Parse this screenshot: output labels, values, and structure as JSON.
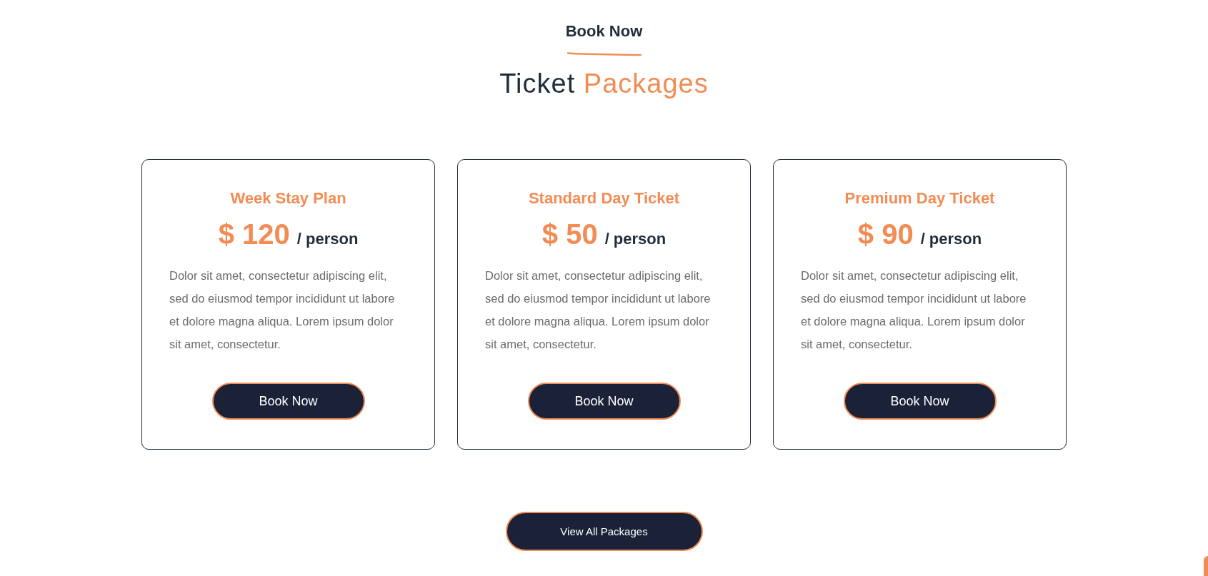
{
  "header": {
    "eyebrow": "Book Now",
    "title": {
      "lead": "Ticket",
      "accent": "Packages"
    }
  },
  "packages": [
    {
      "name": "Week Stay Plan",
      "price": "$ 120",
      "unit": "/ person",
      "description": "Dolor sit amet, consectetur adipiscing elit, sed do eiusmod tempor incididunt ut labore et dolore magna aliqua. Lorem ipsum dolor sit amet, consectetur.",
      "button": "Book Now"
    },
    {
      "name": "Standard Day Ticket",
      "price": "$ 50",
      "unit": "/ person",
      "description": "Dolor sit amet, consectetur adipiscing elit, sed do eiusmod tempor incididunt ut labore et dolore magna aliqua. Lorem ipsum dolor sit amet, consectetur.",
      "button": "Book Now"
    },
    {
      "name": "Premium Day Ticket",
      "price": "$ 90",
      "unit": "/ person",
      "description": "Dolor sit amet, consectetur adipiscing elit, sed do eiusmod tempor incididunt ut labore et dolore magna aliqua. Lorem ipsum dolor sit amet, consectetur.",
      "button": "Book Now"
    }
  ],
  "footer_button": "View All Packages"
}
